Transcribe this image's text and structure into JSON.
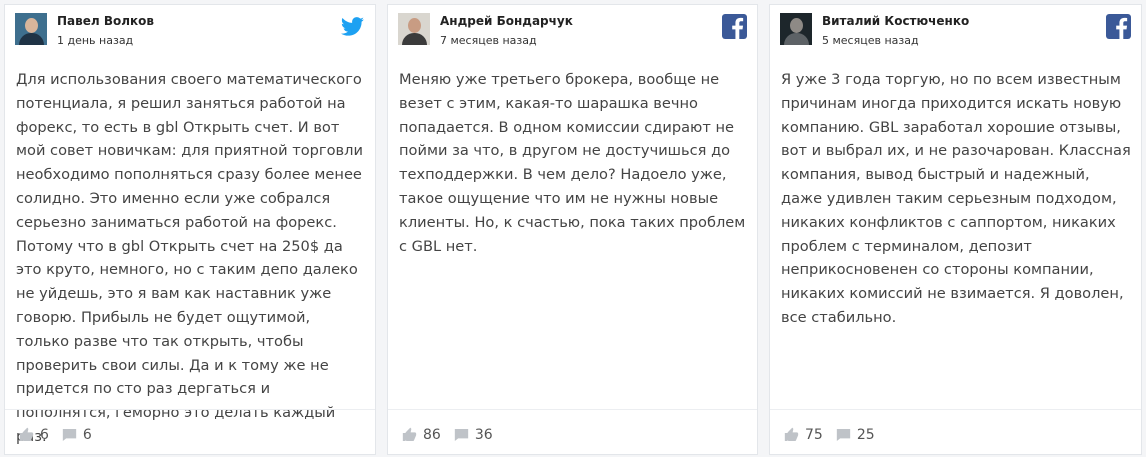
{
  "colors": {
    "twitter": "#1da1f2",
    "facebook": "#3b5998",
    "icon_gray": "#bfc3c8"
  },
  "reviews": [
    {
      "author": "Павел Волков",
      "date": "1 день назад",
      "network": "twitter-icon",
      "text": "Для использования своего математического потенциала, я решил заняться работой на форекс, то есть в gbl Открыть счет. И вот мой совет новичкам: для приятной торговли необходимо пополняться сразу более менее солидно. Это именно если уже собрался серьезно заниматься работой на форекс. Потому что в gbl Открыть счет на 250$ да это круто, немного, но с таким депо далеко не уйдешь, это я вам как наставник уже говорю. Прибыль не будет ощутимой, только разве что так открыть, чтобы проверить свои силы. Да и к тому же не придется по сто раз дергаться и пополнятся, геморно это делать каждый раз.",
      "likes": "6",
      "comments": "6"
    },
    {
      "author": "Андрей Бондарчук",
      "date": "7 месяцев назад",
      "network": "facebook-icon",
      "text": "Меняю уже третьего брокера, вообще не везет с этим, какая-то шарашка вечно попадается. В одном комиссии сдирают не пойми за что, в другом не достучишься до техподдержки. В чем дело? Надоело уже, такое ощущение что им не нужны новые клиенты. Но, к счастью, пока таких проблем с GBL нет.",
      "likes": "86",
      "comments": "36"
    },
    {
      "author": "Виталий Костюченко",
      "date": "5 месяцев назад",
      "network": "facebook-icon",
      "text": "Я уже 3 года торгую, но по всем известным причинам иногда приходится искать новую компанию. GBL заработал хорошие отзывы, вот и выбрал их, и не разочарован. Классная компания, вывод быстрый и надежный, даже удивлен таким серьезным подходом, никаких конфликтов с саппортом, никаких проблем с терминалом, депозит неприкосновенен со стороны компании, никаких комиссий не взимается. Я доволен, все стабильно.",
      "likes": "75",
      "comments": "25"
    }
  ]
}
